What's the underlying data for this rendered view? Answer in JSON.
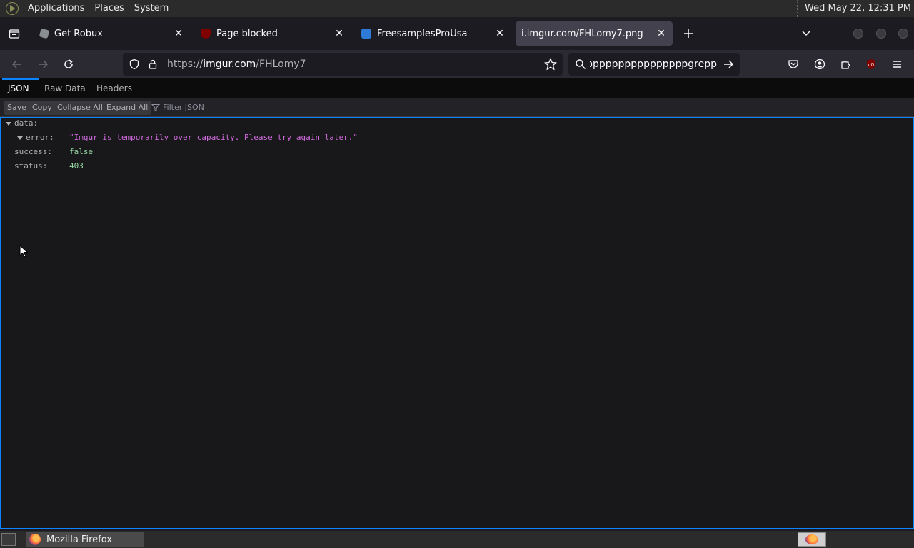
{
  "top_panel": {
    "menus": [
      "Applications",
      "Places",
      "System"
    ],
    "clock": "Wed May 22, 12:31 PM"
  },
  "tabs": [
    {
      "title": "Get Robux",
      "icon": "roblox-icon",
      "close": "✕"
    },
    {
      "title": "Page blocked",
      "icon": "ublock-icon",
      "close": "✕"
    },
    {
      "title": "FreesamplesProUsa",
      "icon": "site-icon",
      "close": "✕"
    },
    {
      "title": "i.imgur.com/FHLomy7.png",
      "icon": "none",
      "close": "✕",
      "active": true
    }
  ],
  "navbar": {
    "url_prefix": "https://",
    "url_host": "imgur.com",
    "url_path": "/FHLomy7",
    "search_text": "pppppppppppppppppppppgrepp"
  },
  "viewer": {
    "tabs": [
      "JSON",
      "Raw Data",
      "Headers"
    ],
    "toolbar": [
      "Save",
      "Copy",
      "Collapse All",
      "Expand All"
    ],
    "filter_placeholder": "Filter JSON"
  },
  "json": {
    "data_key": "data:",
    "error_key": "error:",
    "error_value": "\"Imgur is temporarily over capacity. Please try again later.\"",
    "success_key": "success:",
    "success_value": "false",
    "status_key": "status:",
    "status_value": "403"
  },
  "taskbar": {
    "window_label": "Mozilla Firefox"
  },
  "colors": {
    "accent": "#0a84ff",
    "string": "#d36ce0",
    "keyword": "#95d5a2"
  }
}
